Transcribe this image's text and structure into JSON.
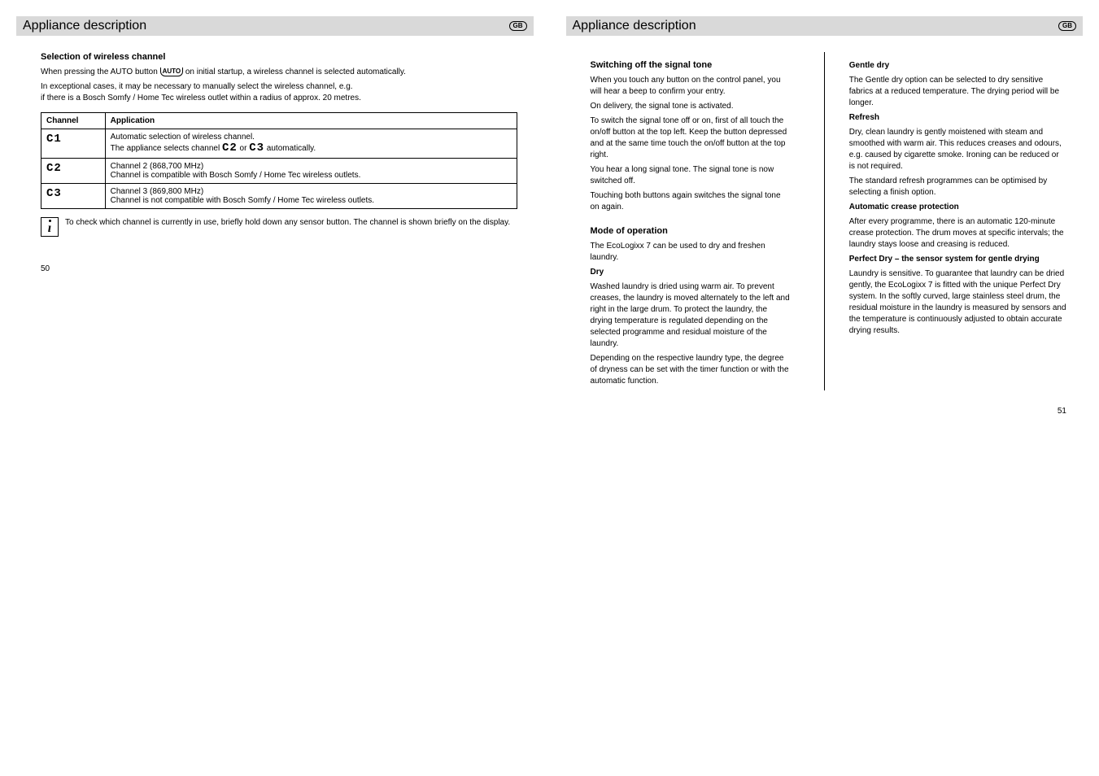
{
  "leftPage": {
    "headerTitle": "Appliance description",
    "gbLabel": "GB",
    "subtitle": "Selection of wireless channel",
    "text1": "When pressing the AUTO button ",
    "text1b": " on initial startup, a wireless channel is selected automatically.",
    "text2": "In exceptional cases, it may be necessary to manually select the wireless channel, e.g.",
    "text2b": "if there is a Bosch Somfy / Home Tec wireless outlet within a radius of approx. 20 metres.",
    "table": {
      "h1": "Channel",
      "h2": "Application",
      "rows": [
        {
          "seg": "C1",
          "text1": "Automatic selection of wireless channel.",
          "text2": "The appliance selects channel ",
          "seg2": "C2",
          "text3": " or ",
          "seg3": "C3",
          "text4": " automatically."
        },
        {
          "seg": "C2",
          "text1": "Channel 2 (868,700 MHz)",
          "text2": "Channel is compatible with Bosch Somfy / Home Tec wireless outlets."
        },
        {
          "seg": "C3",
          "text1": "Channel 3 (869,800 MHz)",
          "text2": "Channel is not compatible with Bosch Somfy / Home Tec wireless outlets."
        }
      ]
    },
    "infoText": "To check which channel is currently in use, briefly hold down any sensor button. The channel is shown briefly on the display.",
    "pageNumber": "50"
  },
  "rightPage": {
    "headerTitle": "Appliance description",
    "gbLabel": "GB",
    "leftCol": {
      "subtitle": "Switching off the signal tone",
      "p1": "When you touch any button on the control panel, you will hear a beep to confirm your entry.",
      "p2": "On delivery, the signal tone is activated.",
      "p3": "To switch the signal tone off or on, first of all touch the on/off button at the top left. Keep the button depressed and at the same time touch the on/off button at the top right.",
      "p4": "You hear a long signal tone. The signal tone is now switched off.",
      "p5": "Touching both buttons again switches the signal tone on again.",
      "subtitle2": "Mode of operation",
      "m1": "The EcoLogixx 7 can be used to dry and freshen laundry.",
      "m2h": "Dry",
      "m2": "Washed laundry is dried using warm air. To prevent creases, the laundry is moved alternately to the left and right in the large drum. To protect the laundry, the drying temperature is regulated depending on the selected programme and residual moisture of the laundry.",
      "m3": "Depending on the respective laundry type, the degree of dryness can be set with the timer function or with the automatic function."
    },
    "rightCol": {
      "r1h": "Gentle dry",
      "r1": "The Gentle dry option can be selected to dry sensitive fabrics at a reduced temperature. The drying period will be longer.",
      "r2h": "Refresh",
      "r2": "Dry, clean laundry is gently moistened with steam and smoothed with warm air. This reduces creases and odours, e.g. caused by cigarette smoke. Ironing can be reduced or is not required.",
      "r3": "The standard refresh programmes can be optimised by selecting a finish option.",
      "r4h": "Automatic crease protection",
      "r4": "After every programme, there is an automatic 120-minute crease protection. The drum moves at specific intervals; the laundry stays loose and creasing is reduced.",
      "r5h": "Perfect Dry – the sensor system for gentle drying",
      "r5": "Laundry is sensitive. To guarantee that laundry can be dried gently, the EcoLogixx 7 is fitted with the unique Perfect Dry system. In the softly curved, large stainless steel drum, the residual moisture in the laundry is measured by sensors and the temperature is continuously adjusted to obtain accurate drying results."
    },
    "pageNumber": "51"
  }
}
